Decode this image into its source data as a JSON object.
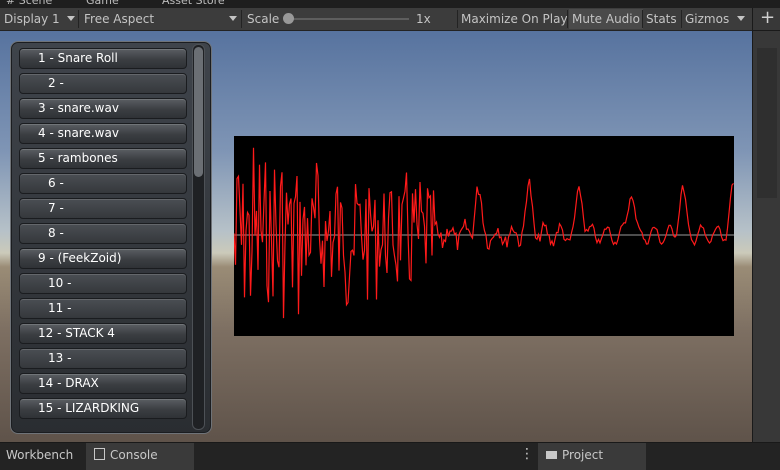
{
  "window": {
    "tabs": [
      "# Scene",
      "Game",
      "Asset Store"
    ]
  },
  "toolbar": {
    "display": "Display 1",
    "aspect": "Free Aspect",
    "scale_label": "Scale",
    "scale_value": "1x",
    "scale_slider_fraction": 0.0,
    "maximize_on_play": "Maximize On Play",
    "mute_audio": "Mute Audio",
    "stats": "Stats",
    "gizmos": "Gizmos"
  },
  "track_list": [
    "1 - Snare Roll",
    "2 -",
    "3 - snare.wav",
    "4 - snare.wav",
    "5 - rambones",
    "6 -",
    "7 -",
    "8 -",
    "9 - (FeekZoid)",
    "10 -",
    "11 -",
    "12 - STACK 4",
    "13 -",
    "14 - DRAX",
    "15 - LIZARDKING"
  ],
  "waveform": {
    "line_color": "#ff1a1a",
    "center_line_color": "#9a9a9a",
    "background": "#000000"
  },
  "bottom_tabs": {
    "workbench": "Workbench",
    "console": "Console",
    "project": "Project"
  },
  "colors": {
    "accent": "#ff1a1a",
    "toolbar_bg": "#3c3c3c"
  }
}
